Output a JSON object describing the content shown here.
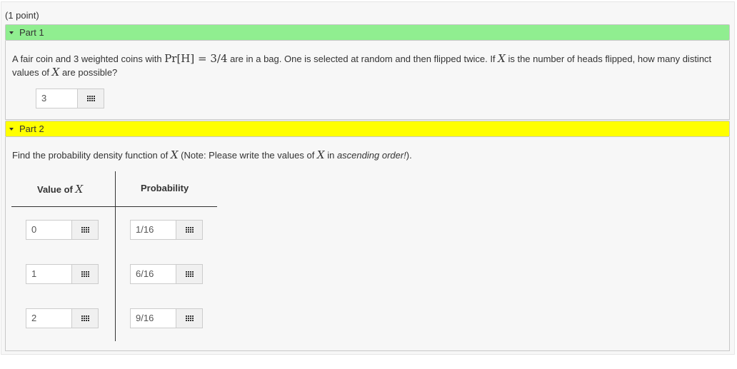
{
  "points": "(1 point)",
  "part1": {
    "title": "Part 1",
    "question_pre": "A fair coin and 3 weighted coins with ",
    "question_math": "Pr[H] = 3/4",
    "question_mid": " are in a bag. One is selected at random and then flipped twice. If ",
    "question_var": "X",
    "question_mid2": " is the number of heads flipped, how many distinct values of ",
    "question_post": " are possible?",
    "answer": "3",
    "answer_icon": "grid-icon"
  },
  "part2": {
    "title": "Part 2",
    "question_pre": "Find the probability density function of ",
    "question_var": "X",
    "question_mid": " (Note: Please write the values of ",
    "question_mid2": " in ",
    "question_emph": "ascending order!",
    "question_post": ").",
    "col1_label": "Value of ",
    "col1_var": "X",
    "col2_label": "Probability",
    "rows": [
      {
        "value": "0",
        "prob": "1/16"
      },
      {
        "value": "1",
        "prob": "6/16"
      },
      {
        "value": "2",
        "prob": "9/16"
      }
    ]
  },
  "colors": {
    "part1_header": "#90ee90",
    "part2_header": "#ffff00"
  }
}
